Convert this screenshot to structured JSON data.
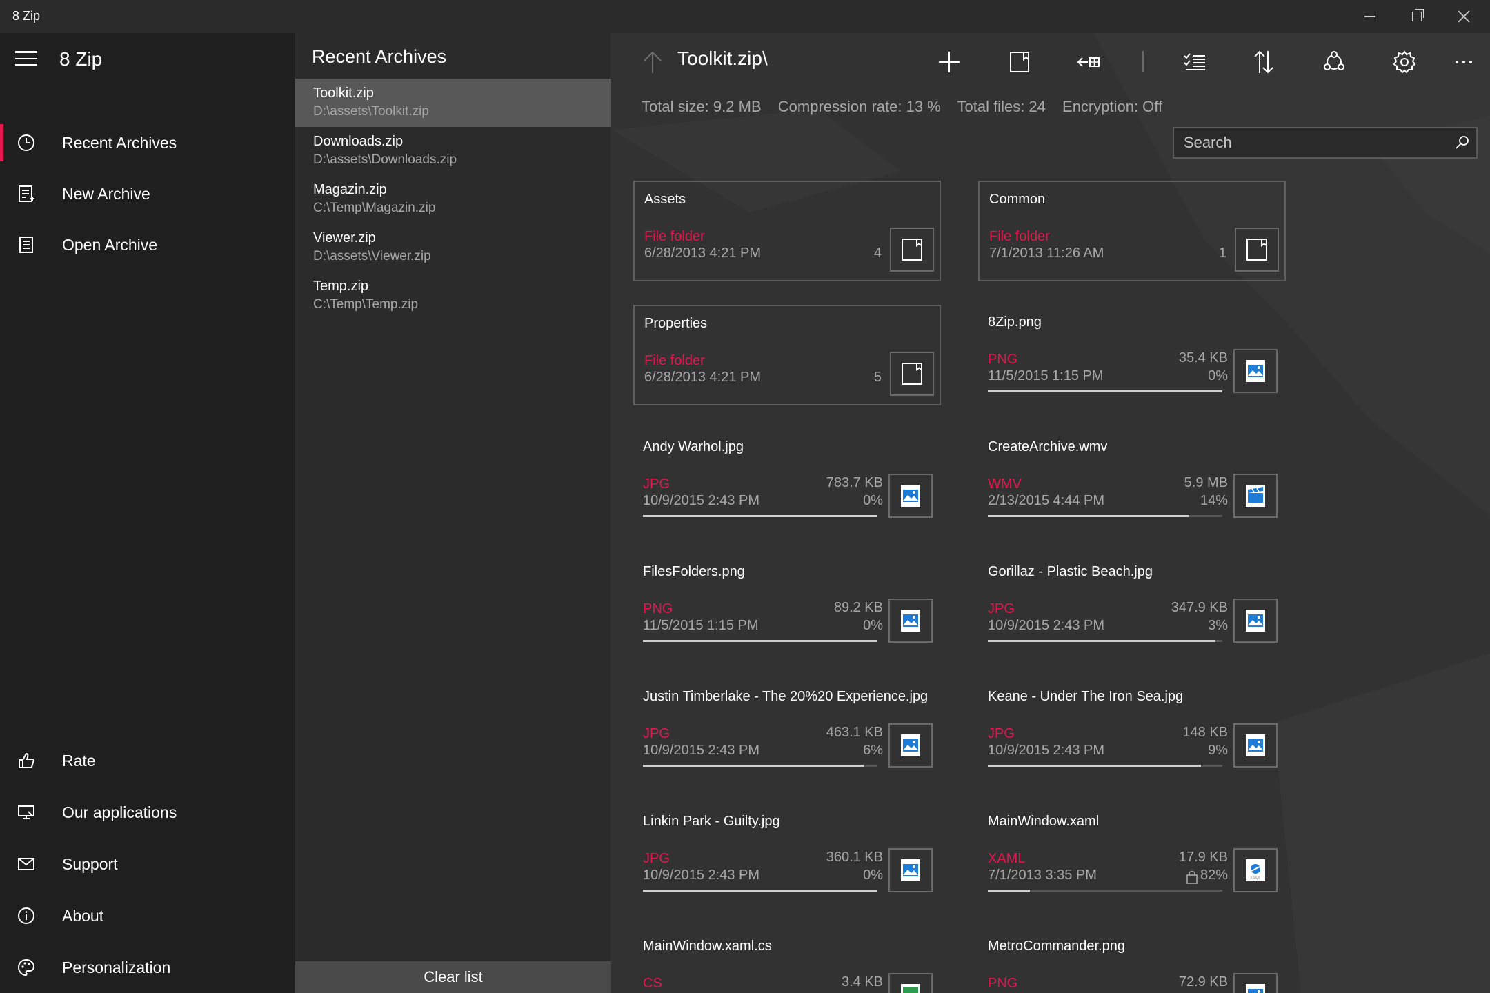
{
  "window": {
    "title": "8 Zip"
  },
  "nav": {
    "brand": "8 Zip",
    "top_items": [
      {
        "label": "Recent Archives",
        "icon": "clock-icon"
      },
      {
        "label": "New Archive",
        "icon": "new-archive-icon"
      },
      {
        "label": "Open Archive",
        "icon": "open-archive-icon"
      }
    ],
    "bottom_items": [
      {
        "label": "Rate",
        "icon": "thumbs-up-icon"
      },
      {
        "label": "Our applications",
        "icon": "store-icon"
      },
      {
        "label": "Support",
        "icon": "mail-icon"
      },
      {
        "label": "About",
        "icon": "info-icon"
      },
      {
        "label": "Personalization",
        "icon": "palette-icon"
      }
    ]
  },
  "recent": {
    "heading": "Recent Archives",
    "items": [
      {
        "name": "Toolkit.zip",
        "path": "D:\\assets\\Toolkit.zip"
      },
      {
        "name": "Downloads.zip",
        "path": "D:\\assets\\Downloads.zip"
      },
      {
        "name": "Magazin.zip",
        "path": "C:\\Temp\\Magazin.zip"
      },
      {
        "name": "Viewer.zip",
        "path": "D:\\assets\\Viewer.zip"
      },
      {
        "name": "Temp.zip",
        "path": "C:\\Temp\\Temp.zip"
      }
    ],
    "clear_label": "Clear list"
  },
  "main": {
    "path": "Toolkit.zip\\",
    "stats": {
      "total_size": "Total size: 9.2 MB",
      "compression": "Compression rate: 13 %",
      "total_files": "Total files: 24",
      "encryption": "Encryption: Off"
    },
    "search_placeholder": "Search",
    "accent": "#e3174e",
    "folders": [
      {
        "name": "Assets",
        "type": "File folder",
        "date": "6/28/2013 4:21 PM",
        "count": "4"
      },
      {
        "name": "Common",
        "type": "File folder",
        "date": "7/1/2013 11:26 AM",
        "count": "1"
      },
      {
        "name": "Properties",
        "type": "File folder",
        "date": "6/28/2013 4:21 PM",
        "count": "5"
      }
    ],
    "files": [
      {
        "name": "8Zip.png",
        "type": "PNG",
        "date": "11/5/2015 1:15 PM",
        "size": "35.4 KB",
        "ratio": "0%",
        "fill": 1.0,
        "icon": "image-file-icon"
      },
      {
        "name": "Andy Warhol.jpg",
        "type": "JPG",
        "date": "10/9/2015 2:43 PM",
        "size": "783.7 KB",
        "ratio": "0%",
        "fill": 1.0,
        "icon": "image-file-icon"
      },
      {
        "name": "CreateArchive.wmv",
        "type": "WMV",
        "date": "2/13/2015 4:44 PM",
        "size": "5.9 MB",
        "ratio": "14%",
        "fill": 0.86,
        "icon": "video-file-icon"
      },
      {
        "name": "FilesFolders.png",
        "type": "PNG",
        "date": "11/5/2015 1:15 PM",
        "size": "89.2 KB",
        "ratio": "0%",
        "fill": 1.0,
        "icon": "image-file-icon"
      },
      {
        "name": "Gorillaz - Plastic Beach.jpg",
        "type": "JPG",
        "date": "10/9/2015 2:43 PM",
        "size": "347.9 KB",
        "ratio": "3%",
        "fill": 0.97,
        "icon": "image-file-icon"
      },
      {
        "name": "Justin Timberlake - The 20%20 Experience.jpg",
        "type": "JPG",
        "date": "10/9/2015 2:43 PM",
        "size": "463.1 KB",
        "ratio": "6%",
        "fill": 0.94,
        "icon": "image-file-icon"
      },
      {
        "name": "Keane - Under The Iron Sea.jpg",
        "type": "JPG",
        "date": "10/9/2015 2:43 PM",
        "size": "148 KB",
        "ratio": "9%",
        "fill": 0.91,
        "icon": "image-file-icon"
      },
      {
        "name": "Linkin Park - Guilty.jpg",
        "type": "JPG",
        "date": "10/9/2015 2:43 PM",
        "size": "360.1 KB",
        "ratio": "0%",
        "fill": 1.0,
        "icon": "image-file-icon"
      },
      {
        "name": "MainWindow.xaml",
        "type": "XAML",
        "date": "7/1/2013 3:35 PM",
        "size": "17.9 KB",
        "ratio": "82%",
        "fill": 0.18,
        "icon": "xaml-file-icon",
        "locked": true
      },
      {
        "name": "MainWindow.xaml.cs",
        "type": "CS",
        "date": "",
        "size": "3.4 KB",
        "ratio": "",
        "fill": 0,
        "icon": "code-file-icon"
      },
      {
        "name": "MetroCommander.png",
        "type": "PNG",
        "date": "",
        "size": "72.9 KB",
        "ratio": "",
        "fill": 0,
        "icon": "image-file-icon"
      }
    ]
  }
}
